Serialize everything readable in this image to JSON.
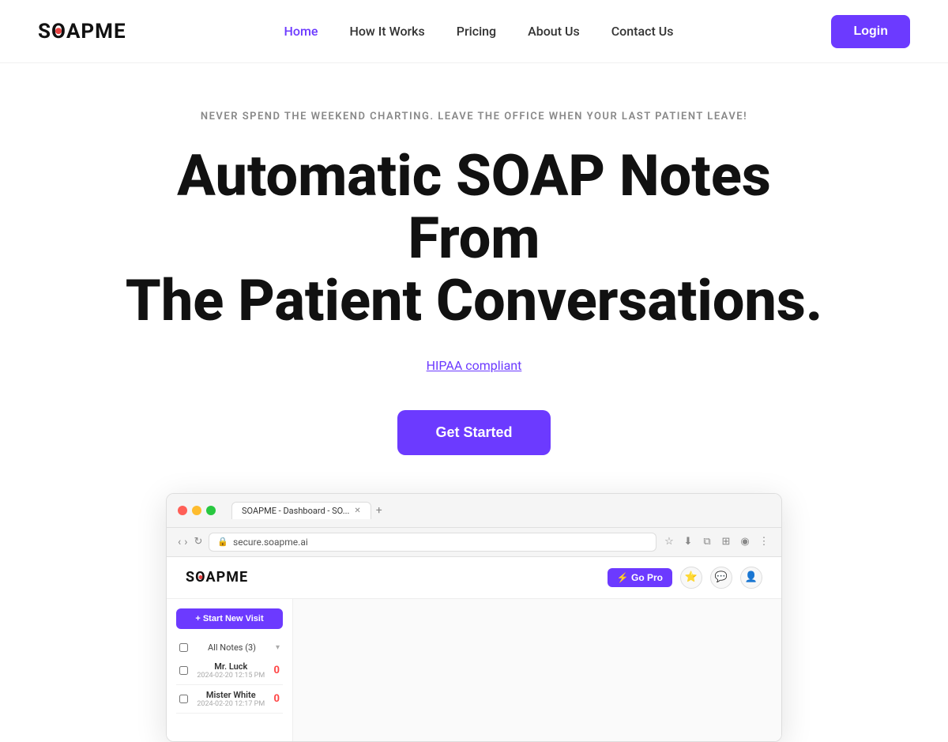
{
  "nav": {
    "logo_text": "SOAPME",
    "links": [
      {
        "label": "Home",
        "active": true
      },
      {
        "label": "How It Works",
        "active": false
      },
      {
        "label": "Pricing",
        "active": false
      },
      {
        "label": "About Us",
        "active": false
      },
      {
        "label": "Contact Us",
        "active": false
      }
    ],
    "login_label": "Login"
  },
  "hero": {
    "tagline": "NEVER SPEND THE WEEKEND CHARTING. LEAVE THE OFFICE WHEN YOUR LAST PATIENT LEAVE!",
    "title_line1": "Automatic SOAP Notes From",
    "title_line2": "The Patient Conversations.",
    "hipaa_link": "HIPAA compliant",
    "get_started": "Get Started"
  },
  "browser": {
    "tab_label": "SOAPME - Dashboard - SO...",
    "tab_plus": "+",
    "address": "secure.soapme.ai",
    "app": {
      "logo": "SOAPME",
      "go_pro": "⚡ Go Pro",
      "star_icon": "⭐",
      "new_visit": "+ Start New Visit",
      "all_notes_label": "All Notes (3)",
      "patients": [
        {
          "name": "Mr. Luck",
          "date": "2024-02-20 12:15 PM",
          "badge": "0"
        },
        {
          "name": "Mister White",
          "date": "2024-02-20 12:17 PM",
          "badge": "0"
        }
      ]
    }
  }
}
